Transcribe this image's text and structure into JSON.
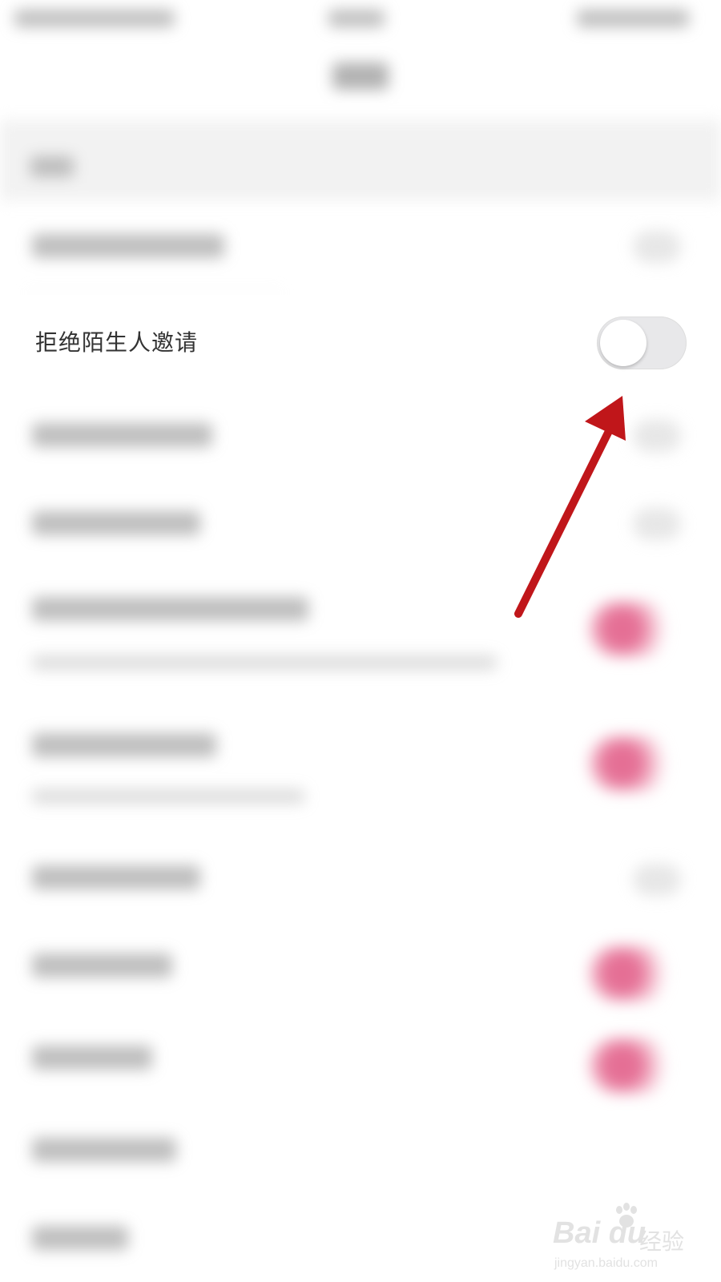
{
  "setting": {
    "label": "拒绝陌生人邀请",
    "enabled": false
  },
  "icons": {
    "annotation": "red-arrow-icon",
    "watermark": "baidu-paw-icon"
  },
  "colors": {
    "arrow": "#c0161a",
    "toggle_off_track": "#e8e8ea",
    "toggle_on": "#e56f95"
  },
  "watermark": {
    "brand": "Bai du",
    "cn": "经验",
    "url": "jingyan.baidu.com"
  }
}
